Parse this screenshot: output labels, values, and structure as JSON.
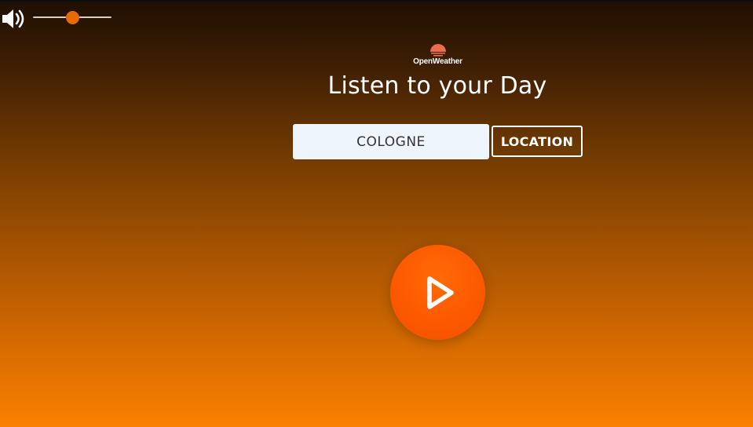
{
  "volume": {
    "icon": "speaker-icon",
    "level": 0.5
  },
  "header": {
    "logo_icon": "sun-logo-icon",
    "logo_text": "OpenWeather",
    "title": "Listen to your Day"
  },
  "search": {
    "value": "COLOGNE",
    "location_label": "LOCATION"
  },
  "player": {
    "icon": "play-icon",
    "accent": "#fc5800"
  },
  "colors": {
    "background_top": "#1e0f03",
    "background_bottom": "#fa8000",
    "slider_thumb": "#e56a00"
  }
}
